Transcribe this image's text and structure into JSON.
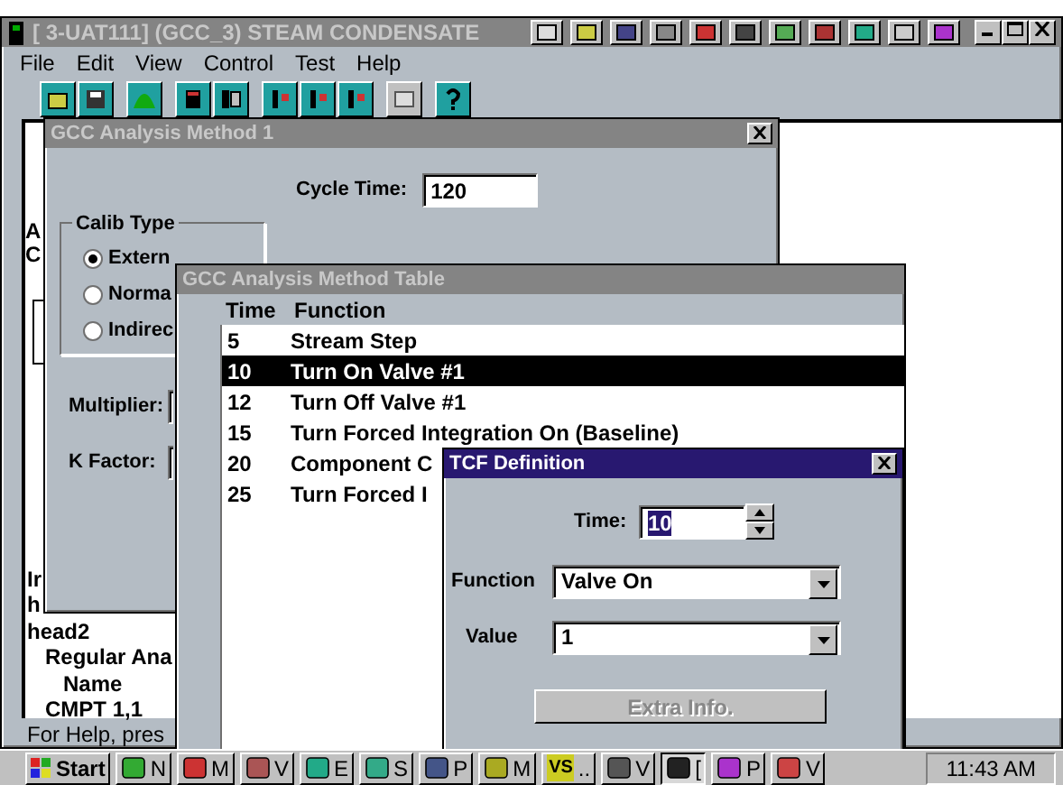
{
  "main_window": {
    "title": "[   3-UAT111] (GCC_3) STEAM CONDENSATE",
    "menu": [
      "File",
      "Edit",
      "View",
      "Control",
      "Test",
      "Help"
    ],
    "side_letters": [
      "A",
      "C"
    ],
    "tree": [
      {
        "text": "Ir"
      },
      {
        "text": "h"
      },
      {
        "text": "head2",
        "children": [
          {
            "text": "Regular Ana",
            "children": [
              {
                "text": "Name"
              }
            ]
          },
          {
            "text": "CMPT 1,1"
          }
        ]
      }
    ],
    "status_text": "For Help, pres"
  },
  "method_window": {
    "title": "GCC Analysis Method 1",
    "cycle_time_label": "Cycle Time:",
    "cycle_time": "120",
    "calib_type": {
      "label": "Calib Type",
      "options": [
        {
          "label": "Extern",
          "selected": true
        },
        {
          "label": "Norma",
          "selected": false
        },
        {
          "label": "Indirec",
          "selected": false
        }
      ]
    },
    "multiplier_label": "Multiplier:",
    "k_factor_label": "K Factor:"
  },
  "table_window": {
    "title": "GCC Analysis Method Table",
    "columns": [
      "Time",
      "Function"
    ],
    "rows": [
      {
        "time": "5",
        "function": "Stream Step",
        "selected": false
      },
      {
        "time": "10",
        "function": "Turn On Valve #1",
        "selected": true
      },
      {
        "time": "12",
        "function": "Turn Off Valve #1",
        "selected": false
      },
      {
        "time": "15",
        "function": "Turn Forced Integration On (Baseline)",
        "selected": false
      },
      {
        "time": "20",
        "function": "Component C",
        "selected": false
      },
      {
        "time": "25",
        "function": "Turn Forced I",
        "selected": false
      }
    ]
  },
  "tcf_dialog": {
    "title": "TCF Definition",
    "time_label": "Time:",
    "time": "10",
    "function_label": "Function",
    "function": "Valve On",
    "value_label": "Value",
    "value": "1",
    "extra_button": {
      "label": "Extra Info.",
      "disabled": true
    }
  },
  "taskbar": {
    "start": "Start",
    "items": [
      {
        "label": "N",
        "selected": false
      },
      {
        "label": "M",
        "selected": false
      },
      {
        "label": "V",
        "selected": false
      },
      {
        "label": "E",
        "selected": false
      },
      {
        "label": "S",
        "selected": false
      },
      {
        "label": "P",
        "selected": false
      },
      {
        "label": "M",
        "selected": false
      },
      {
        "label": "..",
        "icon_text": "VS",
        "selected": false
      },
      {
        "label": "V",
        "selected": false
      },
      {
        "label": "[",
        "selected": true
      },
      {
        "label": "P",
        "selected": false
      },
      {
        "label": "V",
        "selected": false
      }
    ],
    "clock": "11:43 AM"
  }
}
